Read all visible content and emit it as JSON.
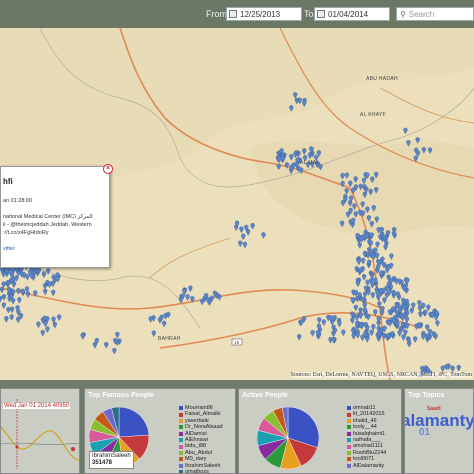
{
  "topbar": {
    "from_label": "From",
    "from_date": "12/25/2013",
    "to_label": "To",
    "to_date": "01/04/2014",
    "search_placeholder": "Search"
  },
  "map": {
    "towns": [
      "ABU HADAH",
      "AL KHAYF",
      "BAHRAH",
      "AL MAL"
    ],
    "road_label": "15",
    "attribution": "Sources: Esri, DeLorme, NAVTEQ, USGS, NRCAN, METI, iPC, TomTom",
    "marker_color": "#5b86c8"
  },
  "popup": {
    "title": "hfi",
    "time": "an 01:28:00",
    "line1": "national Medical Center (IMC) المركز",
    "line2": "ii - @theimcjeddah Jeddah, Western",
    "line3": "://t.co/z4FgHtdoRy",
    "link": "vitter",
    "close_icon": "close-icon"
  },
  "timeline": {
    "header": "Wed Jan 01 2014 40950",
    "tooltip": ""
  },
  "famous_people": {
    "title": "Top Famous People",
    "tooltip_name": "IbrahimSaleeh",
    "tooltip_value": "351478",
    "legend": [
      "Mourrain86",
      "Faisal_Almalki",
      "yaserbale",
      "Dr_NoraAlsaad",
      "AlDamisi",
      "AlEhnawi",
      "bidu_t88",
      "Abu_Abdul",
      "M0_dary",
      "IbrahimSaleeh",
      "omathoss"
    ],
    "colors": [
      "#3a52c4",
      "#c43a3a",
      "#e8a020",
      "#2a9a3a",
      "#8a2aa0",
      "#1aa0b0",
      "#d85a9a",
      "#88c030",
      "#c45a1a",
      "#6a6ad0",
      "#2a6a8a"
    ],
    "slices": [
      24,
      14,
      10,
      9,
      8,
      7,
      7,
      6,
      6,
      5,
      4
    ]
  },
  "active_people": {
    "title": "Active People",
    "legend": [
      "omnab11",
      "lit_20142015",
      "khalid_46",
      "tooly__44",
      "faisalqhaimi1",
      "nafnafa___",
      "amshial1111",
      "RoohBlu2244",
      "tool0071",
      "AlDalamanty"
    ],
    "colors": [
      "#3a52c4",
      "#c43a3a",
      "#e8a020",
      "#2a9a3a",
      "#8a2aa0",
      "#1aa0b0",
      "#d85a9a",
      "#88c030",
      "#c45a1a",
      "#6a6ad0"
    ],
    "slices": [
      30,
      13,
      11,
      9,
      8,
      8,
      7,
      6,
      5,
      3
    ]
  },
  "topics": {
    "title": "Top Topics",
    "words": [
      "alamanty",
      "01",
      "Saudi"
    ]
  }
}
